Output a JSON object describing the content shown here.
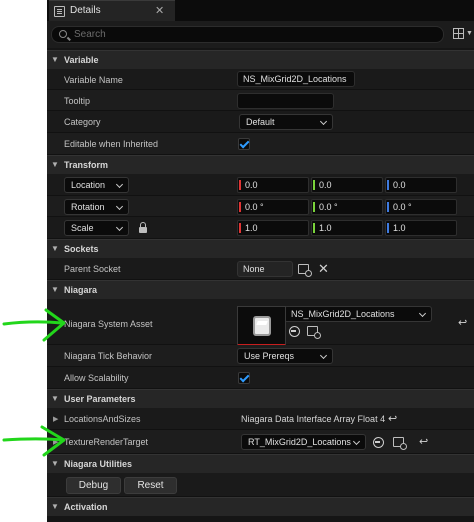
{
  "tab": {
    "label": "Details",
    "close": "✕"
  },
  "search": {
    "placeholder": "Search"
  },
  "categories": {
    "variable": "Variable",
    "transform": "Transform",
    "sockets": "Sockets",
    "niagara": "Niagara",
    "user_parameters": "User Parameters",
    "niagara_utilities": "Niagara Utilities",
    "activation": "Activation"
  },
  "variable": {
    "name_label": "Variable Name",
    "name_value": "NS_MixGrid2D_Locations",
    "tooltip_label": "Tooltip",
    "tooltip_value": "",
    "category_label": "Category",
    "category_value": "Default",
    "editable_label": "Editable when Inherited",
    "editable_checked": true
  },
  "transform": {
    "location_label": "Location",
    "location": [
      "0.0",
      "0.0",
      "0.0"
    ],
    "rotation_label": "Rotation",
    "rotation": [
      "0.0 °",
      "0.0 °",
      "0.0 °"
    ],
    "scale_label": "Scale",
    "scale": [
      "1.0",
      "1.0",
      "1.0"
    ]
  },
  "sockets": {
    "parent_label": "Parent Socket",
    "parent_value": "None"
  },
  "niagara": {
    "system_asset_label": "Niagara System Asset",
    "system_asset_value": "NS_MixGrid2D_Locations",
    "tick_label": "Niagara Tick Behavior",
    "tick_value": "Use Prereqs",
    "scalability_label": "Allow Scalability",
    "scalability_checked": true
  },
  "user_parameters": {
    "locations_label": "LocationsAndSizes",
    "locations_value": "Niagara Data Interface Array Float 4",
    "render_target_label": "TextureRenderTarget",
    "render_target_value": "RT_MixGrid2D_Locations"
  },
  "utilities": {
    "debug_label": "Debug",
    "reset_label": "Reset"
  },
  "colors": {
    "annotation_arrow": "#22d61b",
    "check_blue": "#2f9cff",
    "x_axis": "#e03535",
    "y_axis": "#7ad33b",
    "z_axis": "#3f7be0"
  }
}
